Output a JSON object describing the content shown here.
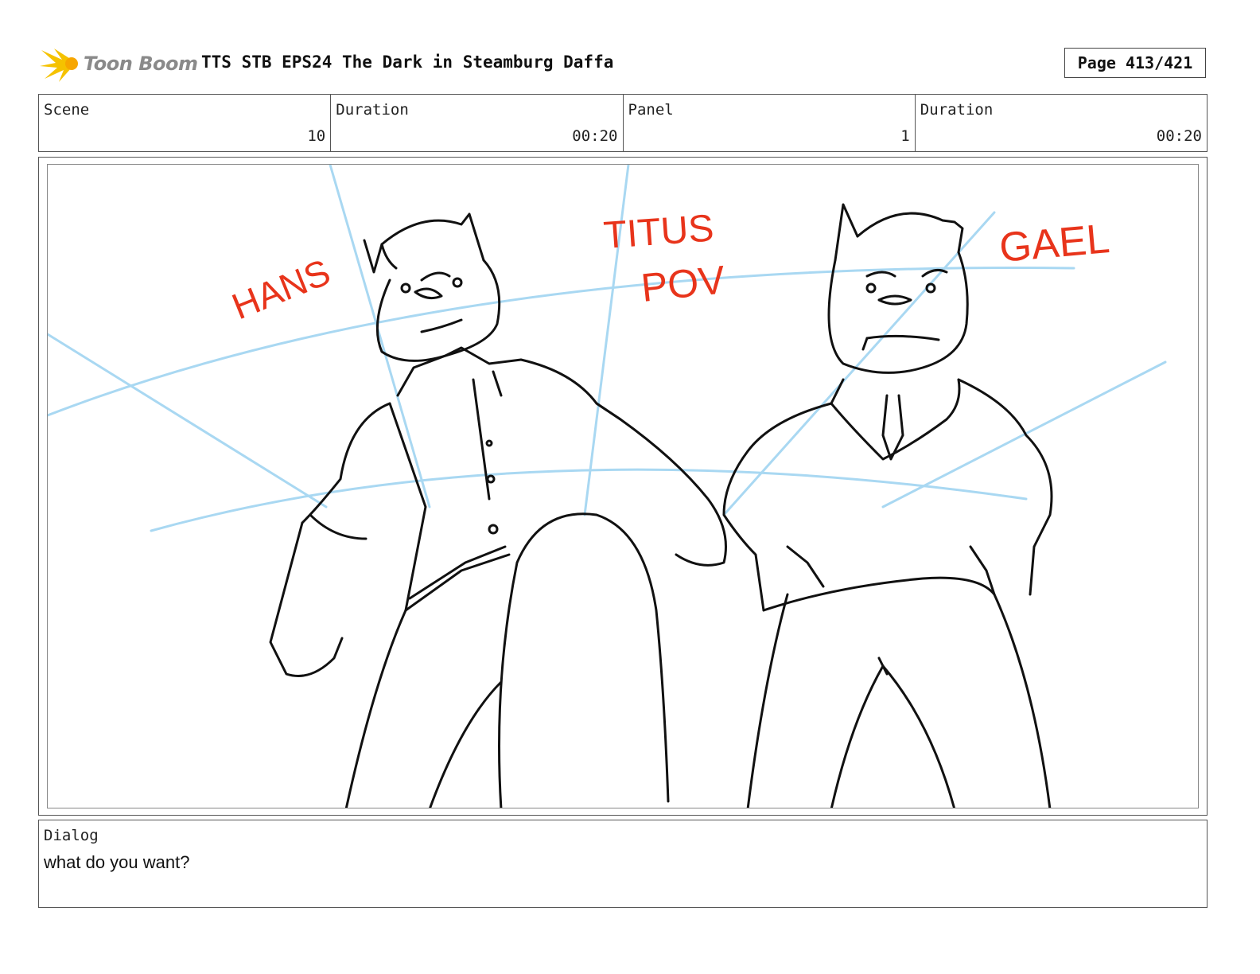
{
  "header": {
    "brand": "Toon Boom",
    "title": "TTS STB EPS24 The Dark in Steamburg Daffa",
    "page": "Page 413/421"
  },
  "info": {
    "scene_label": "Scene",
    "scene_value": "10",
    "duration_label": "Duration",
    "duration_value": "00:20",
    "panel_label": "Panel",
    "panel_value": "1",
    "panel_duration_label": "Duration",
    "panel_duration_value": "00:20"
  },
  "panel": {
    "annotations": {
      "left": "HANS",
      "center_line1": "TITUS",
      "center_line2": "POV",
      "right": "GAEL"
    },
    "annotation_color": "#e8341b",
    "guide_color": "#a9d8f2"
  },
  "dialog": {
    "label": "Dialog",
    "text": "what do you want?"
  }
}
